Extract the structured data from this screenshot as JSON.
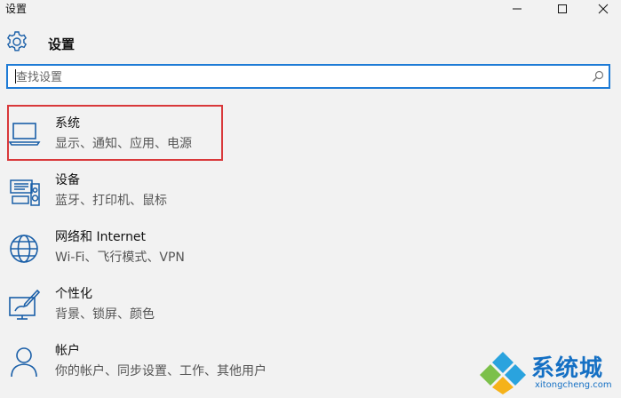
{
  "window": {
    "title": "设置",
    "controls": {
      "minimize": "minimize-icon",
      "maximize": "maximize-icon",
      "close": "close-icon"
    }
  },
  "header": {
    "icon": "gear-icon",
    "title": "设置"
  },
  "search": {
    "value": "",
    "placeholder": "查找设置",
    "icon": "search-icon"
  },
  "categories": [
    {
      "title": "系统",
      "subtitle": "显示、通知、应用、电源",
      "icon": "laptop-icon",
      "highlighted": true
    },
    {
      "title": "设备",
      "subtitle": "蓝牙、打印机、鼠标",
      "icon": "devices-icon",
      "highlighted": false
    },
    {
      "title": "网络和 Internet",
      "subtitle": "Wi-Fi、飞行模式、VPN",
      "icon": "globe-icon",
      "highlighted": false
    },
    {
      "title": "个性化",
      "subtitle": "背景、锁屏、颜色",
      "icon": "personalization-icon",
      "highlighted": false
    },
    {
      "title": "帐户",
      "subtitle": "你的帐户、同步设置、工作、其他用户",
      "icon": "person-icon",
      "highlighted": false
    }
  ],
  "watermark": {
    "text": "系统城",
    "url": "xitongcheng.com"
  },
  "colors": {
    "accent": "#1e7bd6",
    "icon": "#1a5fa8",
    "highlight_border": "#d9383a",
    "background": "#f2f2f2"
  }
}
